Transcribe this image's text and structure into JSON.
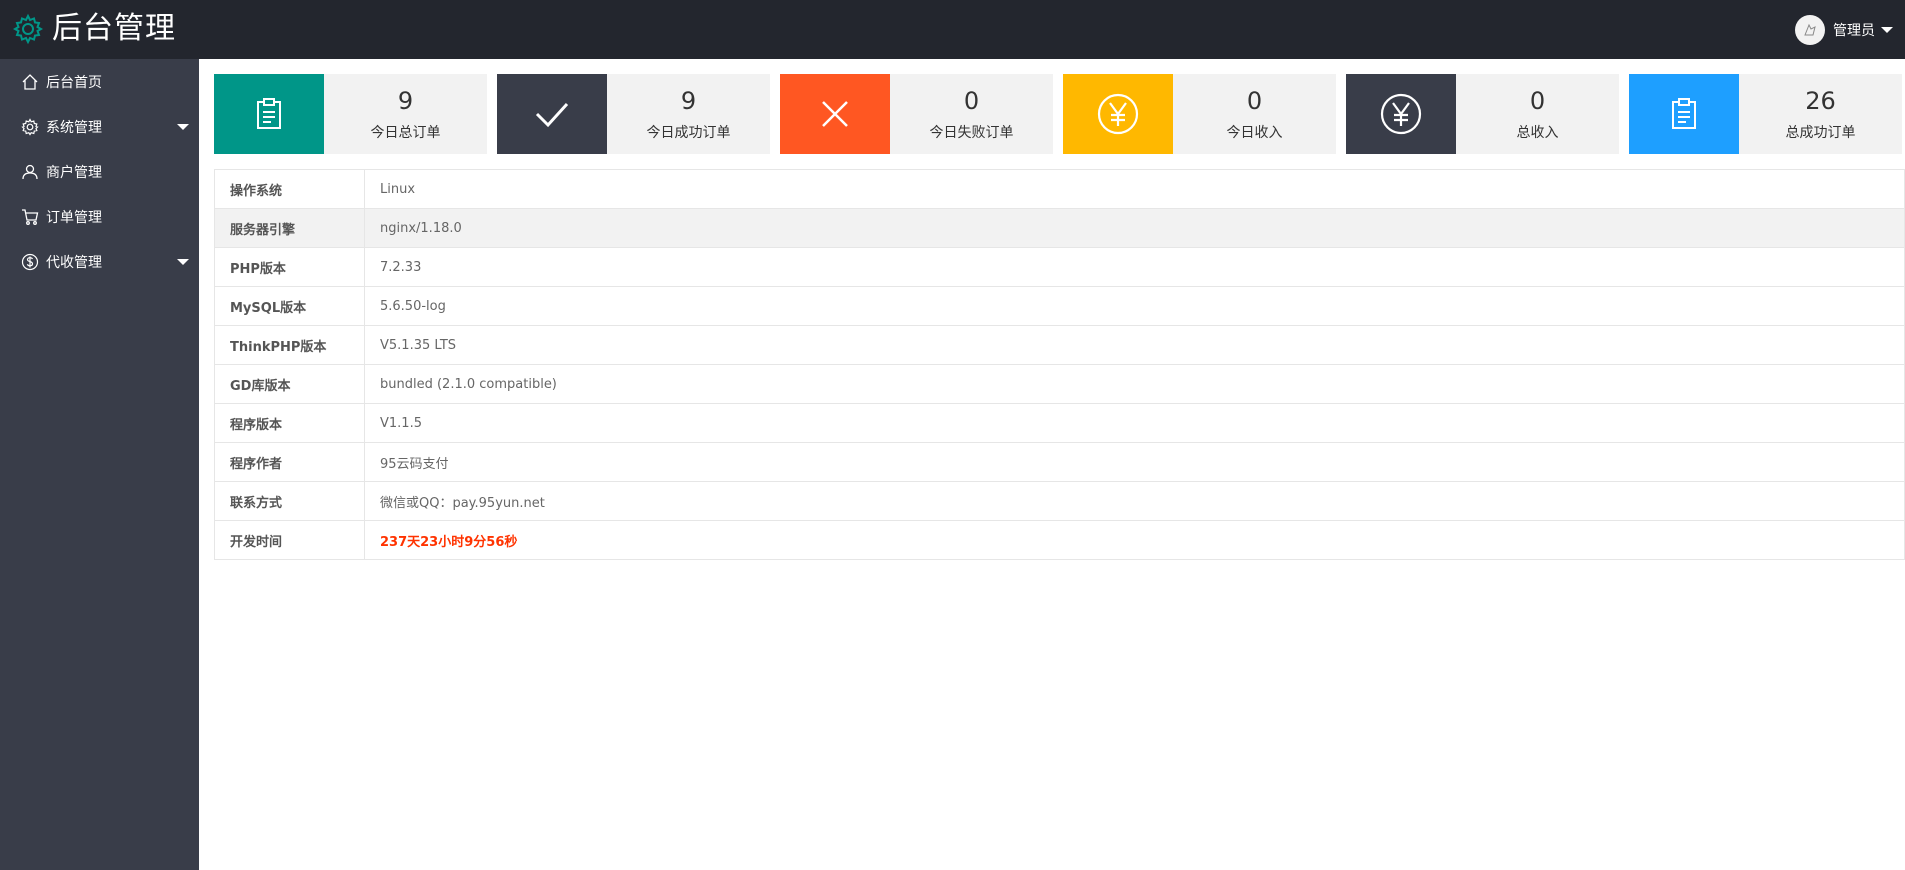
{
  "header": {
    "title": "后台管理",
    "user_name": "管理员",
    "logo_icon": "gear-icon",
    "accent_color": "#009688"
  },
  "sidebar": {
    "items": [
      {
        "label": "后台首页",
        "icon": "home-icon"
      },
      {
        "label": "系统管理",
        "icon": "gear-icon",
        "has_caret": true
      },
      {
        "label": "商户管理",
        "icon": "user-icon"
      },
      {
        "label": "订单管理",
        "icon": "cart-icon"
      },
      {
        "label": "代收管理",
        "icon": "dollar-icon",
        "has_caret": true
      }
    ]
  },
  "cards": [
    {
      "value": "9",
      "label": "今日总订单",
      "color": "#009688",
      "icon": "clipboard-icon"
    },
    {
      "value": "9",
      "label": "今日成功订单",
      "color": "#393d49",
      "icon": "check-icon"
    },
    {
      "value": "0",
      "label": "今日失败订单",
      "color": "#ff5722",
      "icon": "close-icon"
    },
    {
      "value": "0",
      "label": "今日收入",
      "color": "#ffb800",
      "icon": "yen-icon"
    },
    {
      "value": "0",
      "label": "总收入",
      "color": "#393d49",
      "icon": "yen-icon"
    },
    {
      "value": "26",
      "label": "总成功订单",
      "color": "#1e9fff",
      "icon": "clipboard-icon"
    }
  ],
  "info": {
    "rows": [
      {
        "key": "操作系统",
        "value": "Linux"
      },
      {
        "key": "服务器引擎",
        "value": "nginx/1.18.0"
      },
      {
        "key": "PHP版本",
        "value": "7.2.33"
      },
      {
        "key": "MySQL版本",
        "value": "5.6.50-log"
      },
      {
        "key": "ThinkPHP版本",
        "value": "V5.1.35 LTS"
      },
      {
        "key": "GD库版本",
        "value": "bundled (2.1.0 compatible)"
      },
      {
        "key": "程序版本",
        "value": "V1.1.5"
      },
      {
        "key": "程序作者",
        "value": "95云码支付"
      },
      {
        "key": "联系方式",
        "value": "微信或QQ：pay.95yun.net"
      },
      {
        "key": "开发时间",
        "value": "237天23小时9分56秒"
      }
    ],
    "highlight_color": "#ff3300"
  }
}
